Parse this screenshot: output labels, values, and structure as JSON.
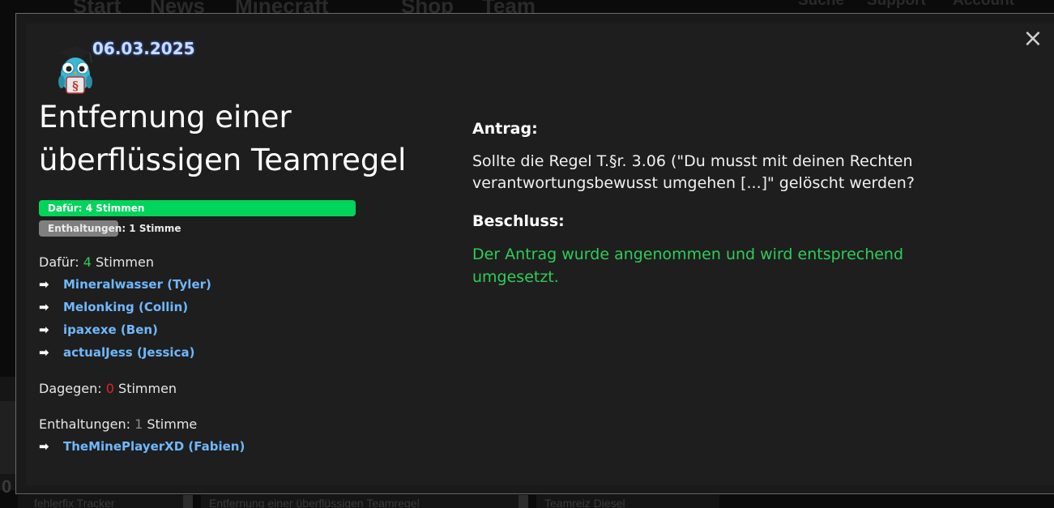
{
  "background": {
    "nav_left": [
      "Start",
      "News",
      "Minecraft",
      "Shop",
      "Team"
    ],
    "nav_right": [
      "Suche",
      "Support",
      "Account"
    ],
    "bottom_tabs": [
      "fehlerfix Tracker",
      "Entfernung einer überflüssigen Teamregel",
      "Teamreiz Diesel"
    ],
    "side_number": "0"
  },
  "modal": {
    "date": "06.03.2025",
    "title": "Entfernung einer überflüssigen Teamregel",
    "close_label": "×",
    "bars": {
      "yes_label": "Dafür: 4 Stimmen",
      "yes_fraction": 0.8,
      "abstain_label": "Enthaltungen:",
      "abstain_rest": " 1 Stimme",
      "abstain_fraction": 0.2
    },
    "for": {
      "label": "Dafür:",
      "count": "4",
      "unit": "Stimmen",
      "voters": [
        "Mineralwasser (Tyler)",
        "Melonking (Collin)",
        "ipaxexe (Ben)",
        "actualJess (Jessica)"
      ]
    },
    "against": {
      "label": "Dagegen:",
      "count": "0",
      "unit": "Stimmen"
    },
    "abstain": {
      "label": "Enthaltungen:",
      "count": "1",
      "unit": "Stimme",
      "voters": [
        "TheMinePlayerXD (Fabien)"
      ]
    },
    "arrow_glyph": "➡",
    "antrag_heading": "Antrag:",
    "antrag_text": "Sollte die Regel T.§r. 3.06 (\"Du musst mit deinen Rechten verantwortungsbewusst umgehen [...]\" gelöscht werden?",
    "beschluss_heading": "Beschluss:",
    "beschluss_text": "Der Antrag wurde angenommen und wird entsprechend umgesetzt."
  },
  "colors": {
    "yes_bar": "#00d45a",
    "abstain_bar": "#7f7f7f",
    "voter_link": "#6fb8ff",
    "beschluss": "#2ecc5a"
  }
}
